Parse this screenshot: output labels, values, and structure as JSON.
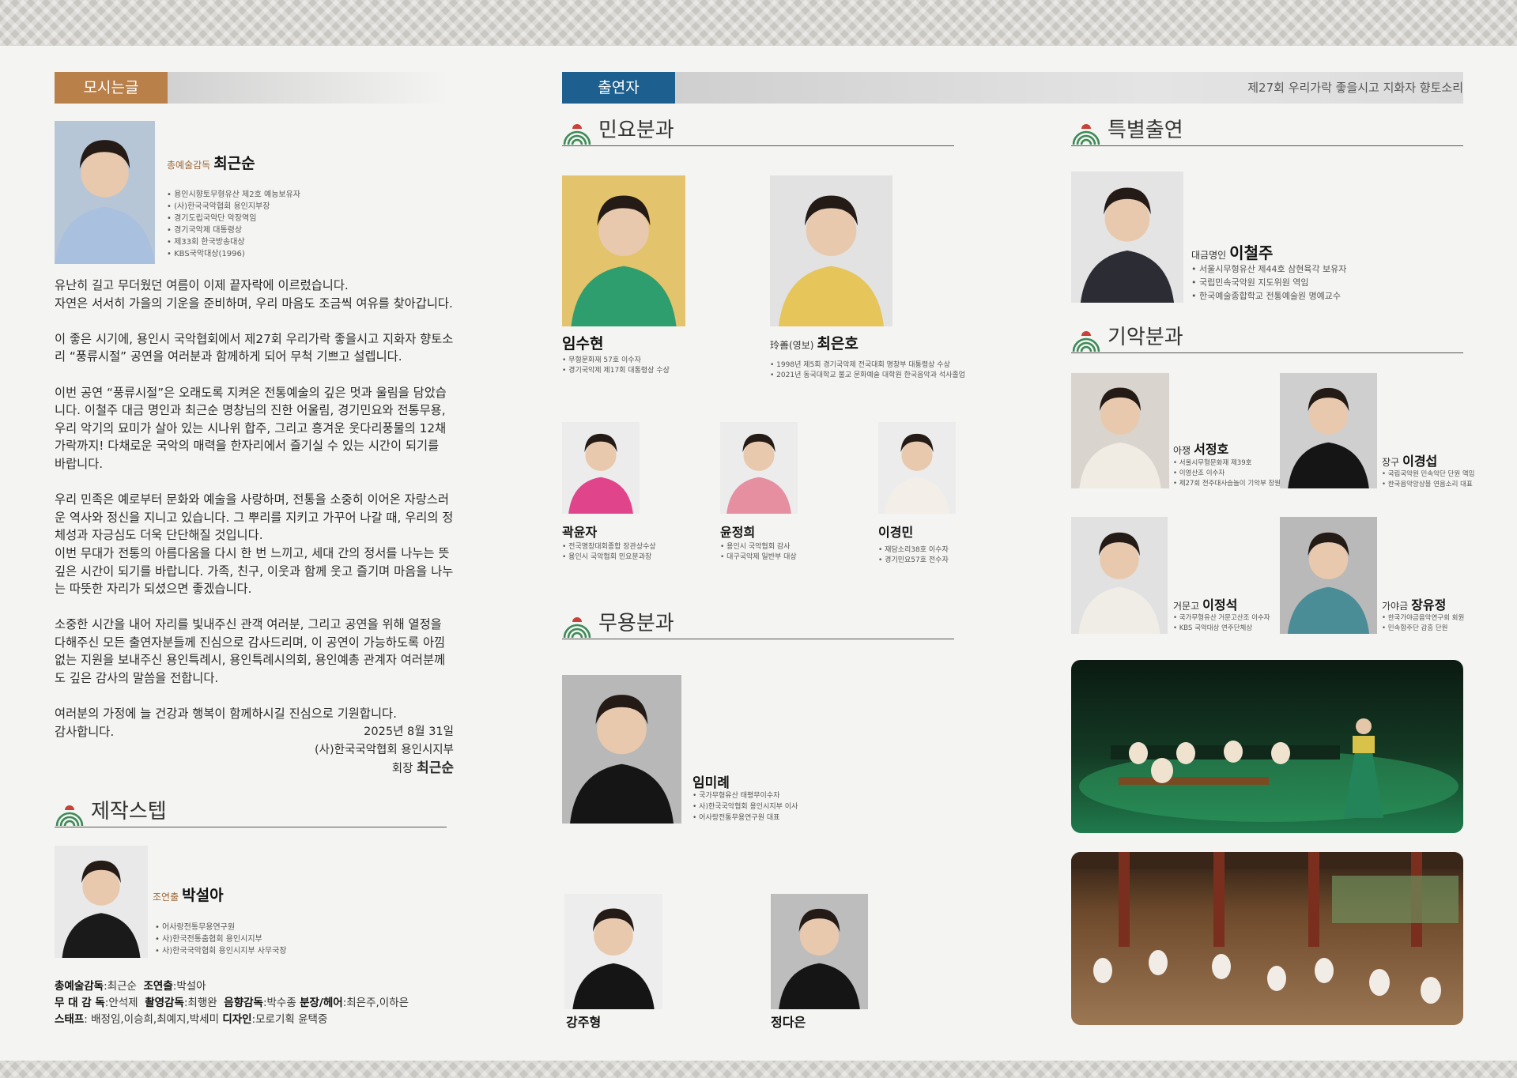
{
  "sections": {
    "greeting": "모시는글",
    "performers": "출연자",
    "event_title": "제27회 우리가락 좋을시고 지화자 향토소리",
    "minyo": "민요분과",
    "muyong": "무용분과",
    "special": "특별출연",
    "giak": "기악분과",
    "staff": "제작스텝"
  },
  "director": {
    "role": "총예술감독",
    "name": "최근순",
    "bullets": [
      "용인시향토무형유산 제2호 예능보유자",
      "(사)한국국악협회 용인지부장",
      "경기도립국악단 악장역임",
      "경기국악제 대통령상",
      "제33회 한국방송대상",
      "KBS국악대상(1996)"
    ]
  },
  "letter": {
    "paragraphs": [
      "유난히 길고 무더웠던 여름이 이제 끝자락에 이르렀습니다.\n자연은 서서히 가을의 기운을 준비하며, 우리 마음도 조금씩 여유를 찾아갑니다.",
      "이 좋은 시기에, 용인시 국악협회에서 제27회 우리가락 좋을시고 지화자 향토소리 “풍류시절” 공연을 여러분과 함께하게 되어 무척 기쁘고 설렙니다.",
      "이번 공연 “풍류시절”은 오래도록 지켜온 전통예술의 깊은 멋과 울림을 담았습니다. 이철주 대금 명인과 최근순 명창님의 진한 어울림, 경기민요와 전통무용, 우리 악기의 묘미가 살아 있는 시나위 합주, 그리고 흥겨운 웃다리풍물의 12채가락까지! 다채로운 국악의 매력을 한자리에서 즐기실 수 있는 시간이 되기를 바랍니다.",
      "우리 민족은 예로부터 문화와 예술을 사랑하며, 전통을 소중히 이어온 자랑스러운 역사와 정신을 지니고 있습니다. 그 뿌리를 지키고 가꾸어 나갈 때, 우리의 정체성과 자긍심도 더욱 단단해질 것입니다.\n이번 무대가 전통의 아름다움을 다시 한 번 느끼고, 세대 간의 정서를 나누는 뜻깊은 시간이 되기를 바랍니다. 가족, 친구, 이웃과 함께 웃고 즐기며 마음을 나누는 따뜻한 자리가 되셨으면 좋겠습니다.",
      "소중한 시간을 내어 자리를 빛내주신 관객 여러분, 그리고 공연을 위해 열정을 다해주신 모든 출연자분들께 진심으로 감사드리며, 이 공연이 가능하도록 아낌없는 지원을 보내주신 용인특례시, 용인특례시의회, 용인예총 관계자 여러분께도 깊은 감사의 말씀을 전합니다.",
      "여러분의 가정에 늘 건강과 행복이 함께하시길 진심으로 기원합니다.\n감사합니다."
    ],
    "date": "2025년 8월 31일",
    "org": "(사)한국국악협회 용인시지부",
    "sign_role": "회장",
    "sign_name": "최근순"
  },
  "assistant_director": {
    "role": "조연출",
    "name": "박설아",
    "bullets": [
      "어사랑전통무용연구원",
      "사)한국전통춤협회 용인시지부",
      "사)한국국악협회 용인시지부 사무국장"
    ]
  },
  "credits": {
    "l1a_label": "총예술감독",
    "l1a_val": ":최근순",
    "l1b_label": "조연출",
    "l1b_val": ":박설아",
    "l2a_label": "무 대 감 독",
    "l2a_val": ":안석제",
    "l2b_label": "촬영감독",
    "l2b_val": ":최행완",
    "l2c_label": "음향감독",
    "l2c_val": ":박수종",
    "l2d_label": "분장/헤어",
    "l2d_val": ":최은주,이하은",
    "l3a_label": "스태프",
    "l3a_val": ": 배정임,이승희,최예지,박세미",
    "l3b_label": "디자인",
    "l3b_val": ":모로기획 윤택중"
  },
  "minyo": [
    {
      "name": "임수현",
      "bullets": [
        "무형문화재 57호 이수자",
        "경기국악제 제17회 대통령상 수상"
      ]
    },
    {
      "role": "玲善(영보)",
      "name": "최은호",
      "bullets": [
        "1998년 제5회 경기국악제 전국대회 명창부 대통령상 수상",
        "2021년 동국대학교 불교 문화예술 대학원 한국음악과 석사졸업"
      ]
    },
    {
      "name": "곽윤자",
      "bullets": [
        "전국명창대회종합 장관상수상",
        "용인시 국악협회 민요분과장"
      ]
    },
    {
      "name": "윤정희",
      "bullets": [
        "용인시 국악협회 감사",
        "대구국악제 일반부 대상"
      ]
    },
    {
      "name": "이경민",
      "bullets": [
        "재담소리38호 이수자",
        "경기민요57호 전수자"
      ]
    }
  ],
  "muyong": [
    {
      "name": "임미례",
      "bullets": [
        "국가무형유산 태평무이수자",
        "사)한국국악협회 용인시지부 이사",
        "어사랑전통무용연구원 대표"
      ]
    },
    {
      "name": "강주형"
    },
    {
      "name": "정다은"
    }
  ],
  "special": {
    "role": "대금명인",
    "name": "이철주",
    "bullets": [
      "서울시무형유산 제44호 삼현육각 보유자",
      "국립민속국악원 지도위원 역임",
      "한국예술종합학교 전통예술원 명예교수"
    ]
  },
  "giak": [
    {
      "role": "아쟁",
      "name": "서정호",
      "bullets": [
        "서울시무형문화재 제39호",
        "이영산조 이수자",
        "제27회 전주대사습놀이 기악부 장원"
      ]
    },
    {
      "role": "장구",
      "name": "이경섭",
      "bullets": [
        "국립국악원 민속악단 단원 역임",
        "한국음악앙상블 연음소리 대표"
      ]
    },
    {
      "role": "거문고",
      "name": "이정석",
      "bullets": [
        "국가무형유산 거문고산조 이수자",
        "KBS 국악대상 연주단체상"
      ]
    },
    {
      "role": "가야금",
      "name": "장유정",
      "bullets": [
        "한국가야금음악연구회 회원",
        "민속합주단 감흥 단원"
      ]
    }
  ],
  "colors": {
    "greeting_tab": "#b9804a",
    "performers_tab": "#1d5f8e",
    "icon_green": "#3d8a57",
    "icon_red": "#c8413a"
  }
}
